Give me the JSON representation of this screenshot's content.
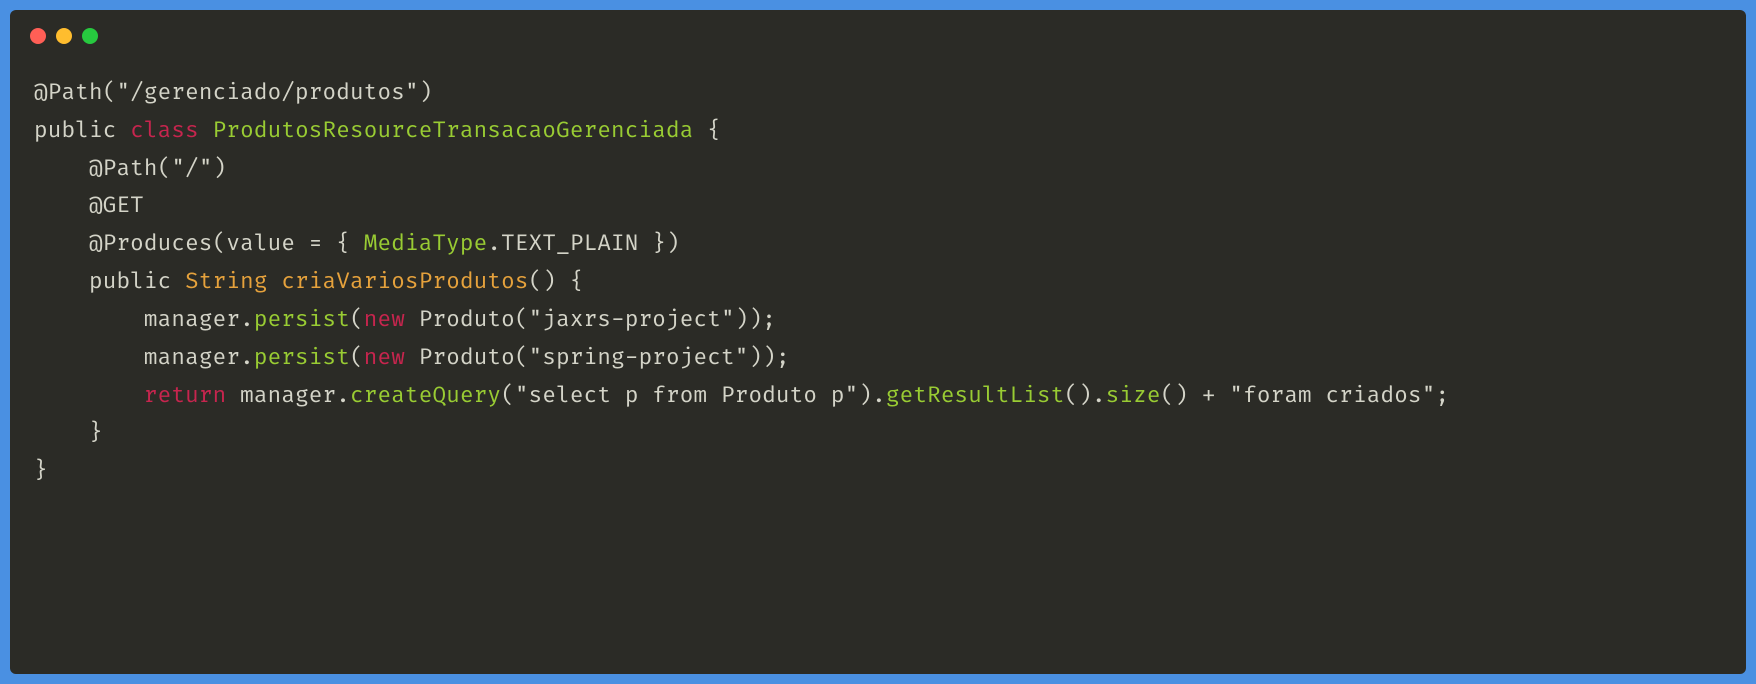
{
  "window": {
    "dots": [
      "red",
      "yellow",
      "green"
    ]
  },
  "code": {
    "line1": {
      "annotation": "@Path",
      "paren_open": "(",
      "string": "\"/gerenciado/produtos\"",
      "paren_close": ")"
    },
    "line2": {
      "public": "public",
      "class_kw": "class",
      "classname": "ProdutosResourceTransacaoGerenciada",
      "brace": " {"
    },
    "line3": {
      "indent": "    ",
      "annotation": "@Path",
      "paren_open": "(",
      "string": "\"/\"",
      "paren_close": ")"
    },
    "line4": {
      "indent": "    ",
      "annotation": "@GET"
    },
    "line5": {
      "indent": "    ",
      "annotation": "@Produces",
      "part1": "(value = { ",
      "mediatype": "MediaType",
      "part2": ".TEXT_PLAIN })"
    },
    "line6": {
      "indent": "    ",
      "public": "public",
      "space1": " ",
      "type": "String",
      "space2": " ",
      "method": "criaVariosProdutos",
      "rest": "() {"
    },
    "line7": {
      "indent": "        ",
      "ident": "manager.",
      "call": "persist",
      "paren": "(",
      "new": "new",
      "space": " ",
      "ctor": "Produto",
      "paren2": "(",
      "string": "\"jaxrs-project\"",
      "end": "));"
    },
    "line8": {
      "indent": "        ",
      "ident": "manager.",
      "call": "persist",
      "paren": "(",
      "new": "new",
      "space": " ",
      "ctor": "Produto",
      "paren2": "(",
      "string": "\"spring-project\"",
      "end": "));"
    },
    "line9": {
      "indent": "        ",
      "return": "return",
      "space": " ",
      "ident": "manager.",
      "call1": "createQuery",
      "paren1": "(",
      "string1": "\"select p from Produto p\"",
      "mid1": ").",
      "call2": "getResultList",
      "mid2": "().",
      "call3": "size",
      "mid3": "() + ",
      "string2": "\"foram criados\"",
      "end": ";"
    },
    "line10": {
      "indent": "    ",
      "brace": "}"
    },
    "line11": {
      "brace": "}"
    }
  }
}
